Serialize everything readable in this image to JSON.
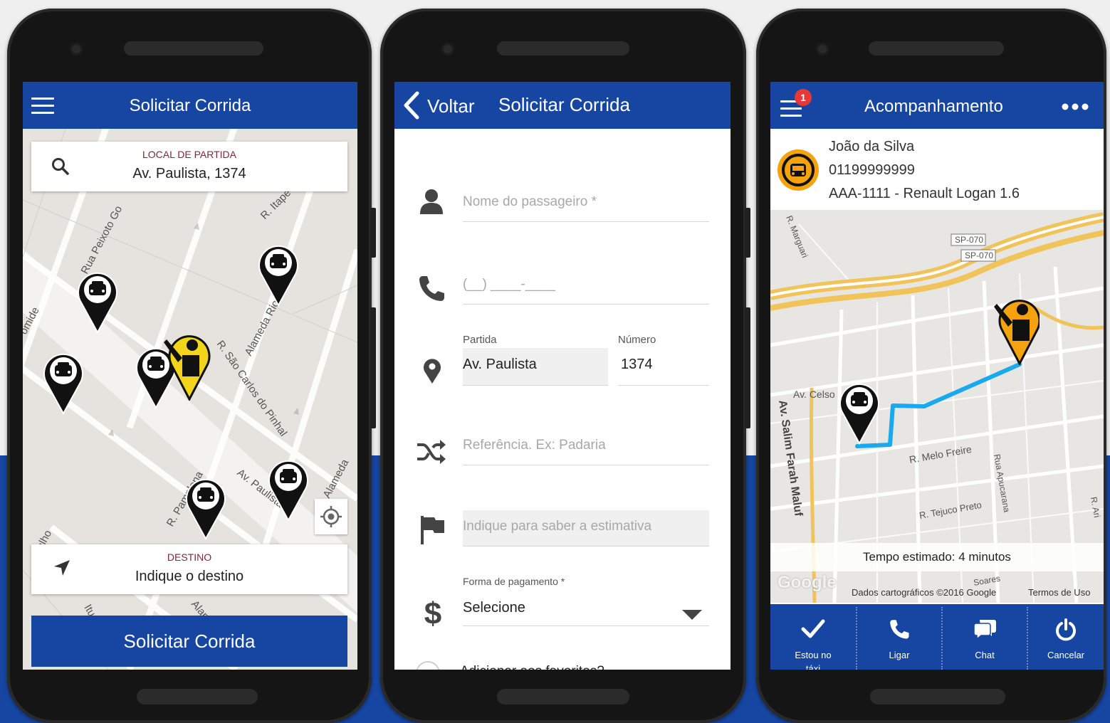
{
  "colors": {
    "brand_blue": "#1746a2",
    "route_blue": "#1aa9ec",
    "highway_orange": "#f0c45a",
    "pin_yellow": "#f2d41a",
    "pin_orange": "#f5a20f",
    "badge_red": "#e53935"
  },
  "phone1": {
    "app_bar": {
      "menu_icon": "hamburger-icon",
      "title": "Solicitar Corrida"
    },
    "origin_card": {
      "icon": "search-icon",
      "label": "LOCAL DE PARTIDA",
      "value": "Av. Paulista, 1374"
    },
    "map_streets": [
      "Rua Peixoto Go",
      "R. Itape",
      "omide",
      "Alameda Rio Claro",
      "R. São Carlos do Pinhal",
      "Av. Paulista",
      "R. Pamplona",
      "Alameda",
      "e Julho",
      "Alam",
      "Itu"
    ],
    "locate_icon": "crosshair-icon",
    "destination_card": {
      "icon": "navigation-arrow-icon",
      "label": "DESTINO",
      "value": "Indique o destino"
    },
    "request_button": "Solicitar Corrida"
  },
  "phone2": {
    "app_bar": {
      "back_icon": "chevron-left-icon",
      "back_label": "Voltar",
      "title": "Solicitar Corrida"
    },
    "form": {
      "passenger": {
        "icon": "person-icon",
        "placeholder": "Nome do passageiro *"
      },
      "phone": {
        "icon": "phone-icon",
        "placeholder": "(__) ____-____"
      },
      "origin": {
        "icon": "location-pin-icon",
        "label": "Partida",
        "value": "Av. Paulista"
      },
      "number": {
        "label": "Número",
        "value": "1374"
      },
      "reference": {
        "icon": "shuffle-icon",
        "placeholder": "Referência. Ex: Padaria"
      },
      "destination": {
        "icon": "flag-icon",
        "placeholder": "Indique para saber a estimativa"
      },
      "payment": {
        "icon": "dollar-icon",
        "label": "Forma de pagamento *",
        "value": "Selecione"
      },
      "favorites": {
        "label": "Adicionar aos favoritos?"
      }
    }
  },
  "phone3": {
    "app_bar": {
      "menu_icon": "hamburger-icon",
      "badge": "1",
      "title": "Acompanhamento",
      "more_icon": "more-dots-icon"
    },
    "driver": {
      "avatar_icon": "taxi-icon",
      "name": "João da Silva",
      "phone": "01199999999",
      "vehicle": "AAA-1111 - Renault Logan 1.6"
    },
    "map_streets": [
      "R. Marguari",
      "SP-070",
      "SP-070",
      "Av. Celso",
      "Av. Salim Farah Maluf",
      "R. Melo Freire",
      "Rua Apucarana",
      "R. Tejuco Preto",
      "Soares",
      "R. Ari"
    ],
    "eta": "Tempo estimado: 4 minutos",
    "google_logo": "Google",
    "attribution": "Dados cartográficos ©2016 Google",
    "terms": "Termos de Uso",
    "actions": [
      {
        "icon": "check-icon",
        "label": "Estou no táxi"
      },
      {
        "icon": "phone-icon",
        "label": "Ligar"
      },
      {
        "icon": "chat-icon",
        "label": "Chat"
      },
      {
        "icon": "power-icon",
        "label": "Cancelar"
      }
    ]
  }
}
